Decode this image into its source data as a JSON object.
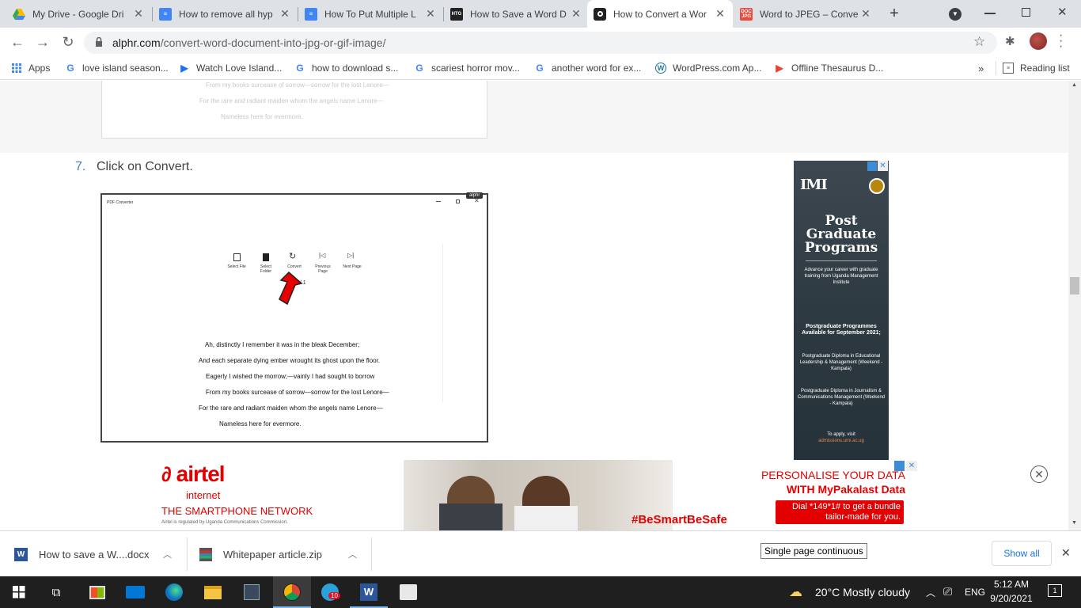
{
  "tabs": [
    {
      "title": "My Drive - Google Dri",
      "icon": "google-drive-icon"
    },
    {
      "title": "How to remove all hyp",
      "icon": "google-docs-icon"
    },
    {
      "title": "How To Put Multiple L",
      "icon": "google-docs-icon"
    },
    {
      "title": "How to Save a Word D",
      "icon": "htg-icon"
    },
    {
      "title": "How to Convert a Wor",
      "icon": "alphr-icon",
      "active": true
    },
    {
      "title": "Word to JPEG – Conve",
      "icon": "doc-jpg-icon"
    }
  ],
  "toolbar": {
    "url_host": "alphr.com",
    "url_path": "/convert-word-document-into-jpg-or-gif-image/"
  },
  "bookmarks": {
    "apps": "Apps",
    "items": [
      "love island season...",
      "Watch Love Island...",
      "how to download s...",
      "scariest horror mov...",
      "another word for ex...",
      "WordPress.com Ap...",
      "Offline Thesaurus D..."
    ],
    "more": "»",
    "reading_list": "Reading list"
  },
  "article": {
    "top_image_lines": [
      "From my books surcease of sorrow—sorrow for the lost Lenore—",
      "For the rare and radiant maiden whom the angels name Lenore—",
      "Nameless here for evermore."
    ],
    "step_number": "7.",
    "step_text": "Click on Convert.",
    "screenshot": {
      "window_title": "PDF Converter",
      "badge": "alphr",
      "buttons": [
        {
          "label": "Select File"
        },
        {
          "label": "Select Folder"
        },
        {
          "label": "Convert"
        },
        {
          "label": "Previous Page"
        },
        {
          "label": "Next Page"
        }
      ],
      "page_indicator": "1 / 1",
      "poem": [
        "Ah, distinctly I remember it was in the bleak December;",
        "And each separate dying ember wrought its ghost upon the floor.",
        "Eagerly I wished the morrow;—vainly I had sought to borrow",
        "From my books surcease of sorrow—sorrow for the lost Lenore—",
        "For the rare and radiant maiden whom the angels name Lenore—",
        "Nameless here for evermore."
      ]
    }
  },
  "ad_right": {
    "logo": "IMI",
    "headline": [
      "Post",
      "Graduate",
      "Programs"
    ],
    "tagline": "Advance your career with graduate training from Uganda Management Institute",
    "available": "Postgraduate Programmes Available for September 2021;",
    "program1": "Postgraduate Diploma in Educational Leadership & Management (Weekend - Kampala)",
    "program2": "Postgraduate Diploma in Journalism & Communications Management (Weekend - Kampala)",
    "apply": "To apply, visit",
    "apply_url": "admissions.umi.ac.ug"
  },
  "ad_bottom": {
    "brand": "airtel",
    "sub": "internet",
    "network": "THE SMARTPHONE NETWORK",
    "regulated": "Airtel is regulated by Uganda Communications Commission.",
    "personalise_1": "PERSONALISE YOUR DATA",
    "personalise_2": "WITH MyPakalast Data",
    "dial_1": "Dial *149*1# to get a bundle",
    "dial_2": "tailor-made for you.",
    "hashtag": "#BeSmartBeSafe"
  },
  "downloads": {
    "items": [
      {
        "name": "How to save a W....docx"
      },
      {
        "name": "Whitepaper article.zip"
      }
    ],
    "tooltip": "Single page continuous",
    "show_all": "Show all"
  },
  "taskbar": {
    "weather": "20°C  Mostly cloudy",
    "lang": "ENG",
    "time": "5:12 AM",
    "date": "9/20/2021",
    "notifications": "1",
    "badge": "10"
  },
  "colors": {
    "airtel_red": "#e40000",
    "link_blue": "#3d7dca"
  }
}
